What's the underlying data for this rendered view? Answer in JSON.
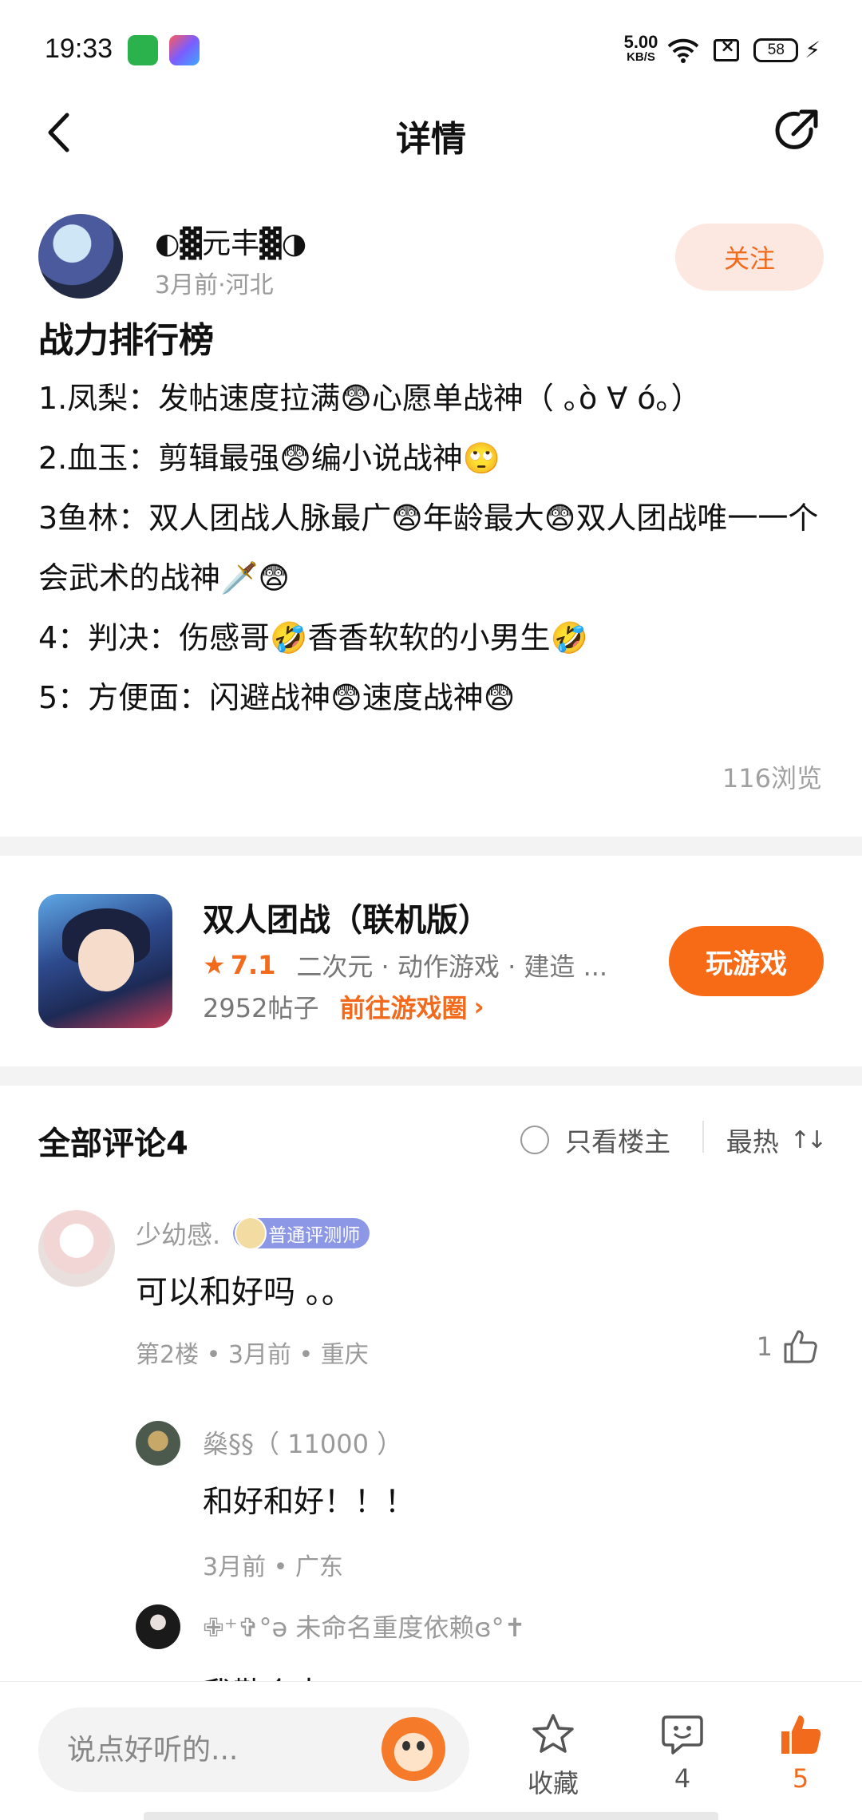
{
  "status_bar": {
    "time": "19:33",
    "net_speed_value": "5.00",
    "net_speed_unit": "KB/S",
    "battery": "58"
  },
  "header": {
    "title": "详情"
  },
  "post": {
    "author_name": "◐▓元丰▓◑",
    "author_meta": "3月前·河北",
    "follow_label": "关注",
    "title": "战力排行榜",
    "lines": [
      "1.凤梨：发帖速度拉满😨心愿单战神（ ｡ò ∀ ó｡）",
      "2.血玉：剪辑最强😨编小说战神🙄",
      "3鱼林：双人团战人脉最广😨年龄最大😨双人团战唯一一个会武术的战神🗡️😨",
      "4：判决：伤感哥🤣香香软软的小男生🤣",
      "5：方便面：闪避战神😨速度战神😨"
    ],
    "views": "116浏览"
  },
  "game": {
    "name": "双人团战（联机版）",
    "rating": "7.1",
    "tags": "二次元 · 动作游戏 · 建造 ...",
    "post_count": "2952帖子",
    "goto_label": "前往游戏圈",
    "play_label": "玩游戏"
  },
  "comments": {
    "title": "全部评论4",
    "only_owner_label": "只看楼主",
    "sort_label": "最热",
    "items": [
      {
        "user": "少幼感.",
        "badge": "普通评测师",
        "text": "可以和好吗 。。",
        "meta": "第2楼 • 3月前 • 重庆",
        "likes": "1"
      }
    ],
    "replies": [
      {
        "user": "燊§§（ 11000 ）",
        "text": "和好和好！！！",
        "meta": "3月前 • 广东"
      },
      {
        "user": "✙⁺✞°ə 未命名重度依赖ɞ°✝",
        "text": "我勒个去"
      }
    ]
  },
  "bottom_bar": {
    "input_placeholder": "说点好听的...",
    "favorite_label": "收藏",
    "comment_count": "4",
    "like_count": "5"
  }
}
